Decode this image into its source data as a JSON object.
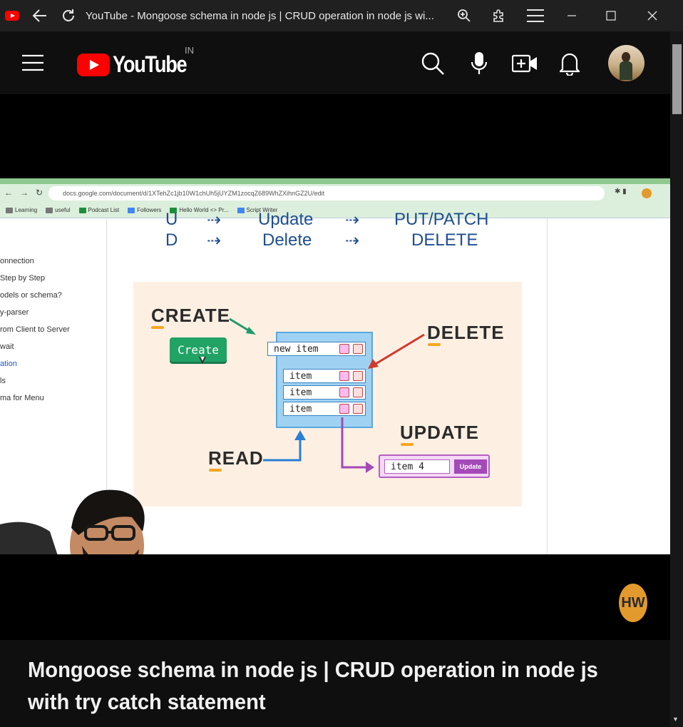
{
  "window": {
    "title": "YouTube - Mongoose schema in node js | CRUD operation in node js wi...",
    "favicon": "youtube-favicon"
  },
  "header": {
    "logo_text": "YouTube",
    "region": "IN",
    "icons": [
      "menu-icon",
      "search-icon",
      "mic-icon",
      "create-video-icon",
      "bell-icon",
      "avatar"
    ]
  },
  "video": {
    "browser": {
      "url": "docs.google.com/document/d/1XTehZc1jb10W1chUh5jUYZM1zocqZ689WhZXihnGZ2U/edit",
      "bookmarks": [
        "Learning",
        "useful",
        "Podcast List",
        "Followers",
        "Hello World <> Pr...",
        "Script Writer"
      ]
    },
    "outline": [
      "onnection",
      "Step by Step",
      "odels or schema?",
      "y-parser",
      "rom Client to Server",
      "wait",
      "ation",
      "ls",
      "ma for Menu"
    ],
    "crud_rows": [
      {
        "letter": "U",
        "op": "Update",
        "method": "PUT/PATCH"
      },
      {
        "letter": "D",
        "op": "Delete",
        "method": "DELETE"
      }
    ],
    "diagram": {
      "create_label": "CREATE",
      "create_button": "Create",
      "delete_label": "DELETE",
      "update_label": "UPDATE",
      "read_label": "READ",
      "new_item": "new item",
      "items": [
        "item",
        "item",
        "item"
      ],
      "update_field": "item 4",
      "update_button": "Update"
    },
    "channel_badge": "HW"
  },
  "video_title": "Mongoose schema in node js | CRUD operation in node js with try catch statement",
  "colors": {
    "youtube_red": "#ff0000",
    "background": "#0f0f0f",
    "crud_blue": "#1f4e8f",
    "create_green": "#21a366",
    "update_purple": "#a349b8"
  }
}
